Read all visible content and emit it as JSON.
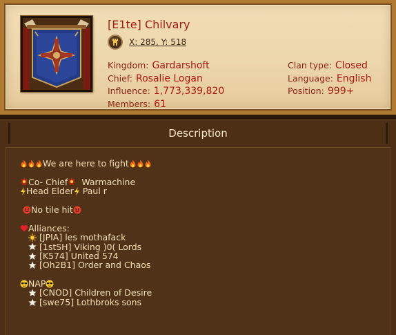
{
  "clan": {
    "name": "[E1te] Chilvary",
    "coordinates": "X: 285, Y: 518"
  },
  "info_left": [
    {
      "label": "Kingdom:",
      "value": "Gardarshoft"
    },
    {
      "label": "Chief:",
      "value": "Rosalie Logan"
    },
    {
      "label": "Influence:",
      "value": "1,773,339,820"
    },
    {
      "label": "Members:",
      "value": "61"
    }
  ],
  "info_right": [
    {
      "label": "Clan type:",
      "value": "Closed"
    },
    {
      "label": "Language:",
      "value": "English"
    },
    {
      "label": "Position:",
      "value": "999+"
    }
  ],
  "description": {
    "title": "Description",
    "motto": "We are here to fight",
    "co_chief_label": "Co- Chief",
    "co_chief_name": "Warmachine",
    "head_elder_label": "Head Elder",
    "head_elder_name": "Paul r",
    "rule": "No tile hit",
    "alliances_title": "Alliances:",
    "alliances": [
      "[JPIA] les mothafack",
      "[1stSH] Viking )0( Lords",
      "[K574] United 574",
      "[Oh2B1] Order and Chaos"
    ],
    "nap_title": "NAP",
    "naps": [
      "[CNOD] Children of Desire",
      "[swe75] Lothbroks sons"
    ]
  },
  "icons": {
    "coordinate": "map-location-icon",
    "emblem": "clan-banner-emblem",
    "fire": "fire-emoji-icon",
    "collision": "collision-emoji-icon",
    "lightning": "lightning-emoji-icon",
    "angry": "angry-face-emoji-icon",
    "heart": "heart-emoji-icon",
    "sun": "sun-emoji-icon",
    "star": "star-emoji-icon",
    "sunglasses": "sunglasses-face-emoji-icon"
  },
  "colors": {
    "clan_text": "#9b1d12",
    "label_text": "#8a2414",
    "value_text": "#a8180e",
    "description_text": "#f3e0b4",
    "parchment": "#ecd5aa",
    "panel_bg": "#4f3217"
  }
}
